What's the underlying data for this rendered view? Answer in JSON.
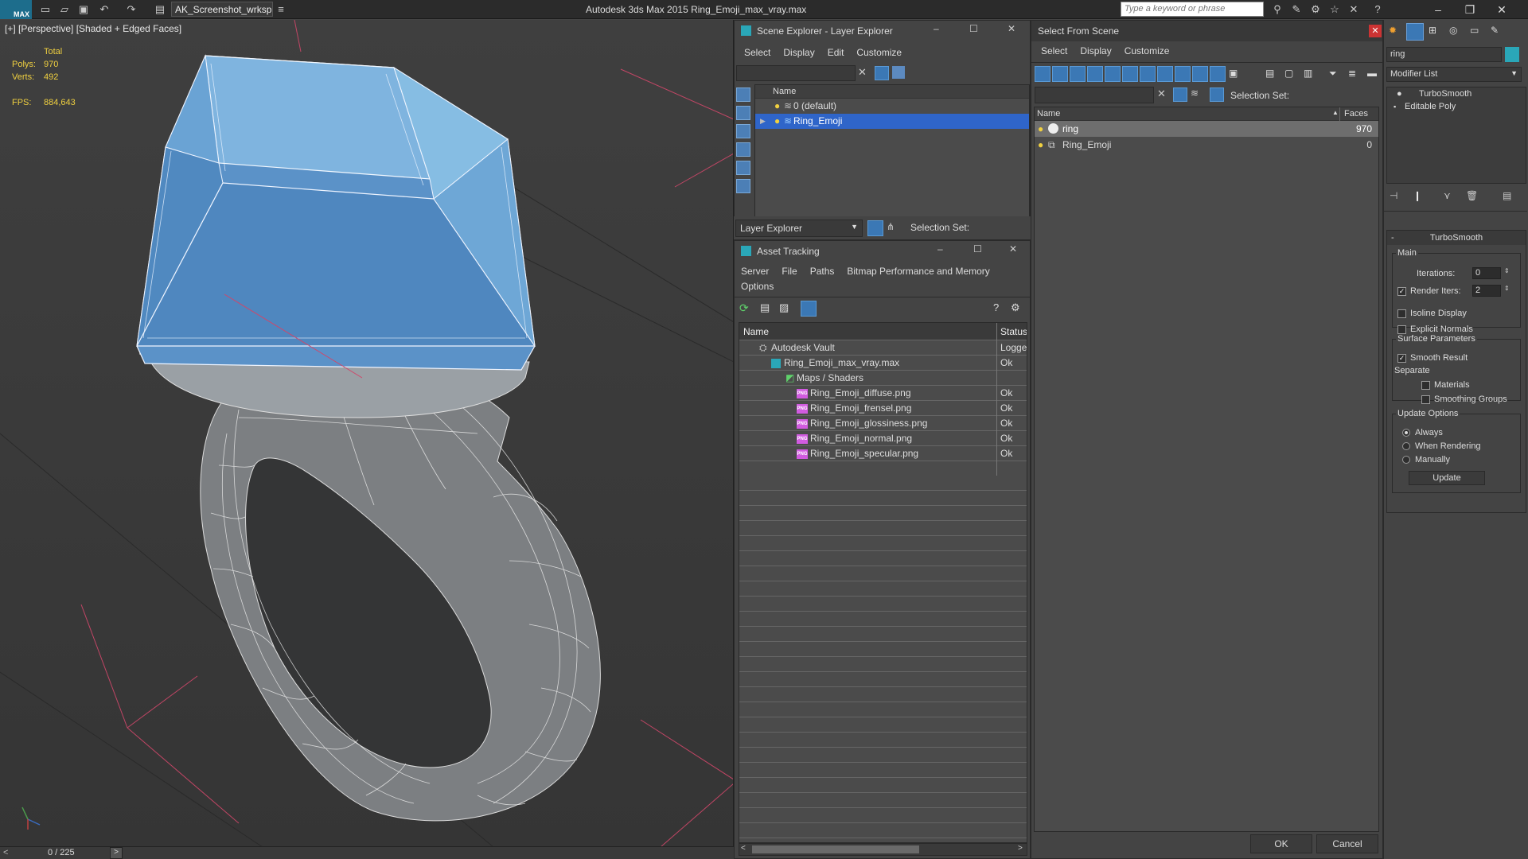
{
  "titlebar": {
    "logo": "MAX",
    "workspace": "AK_Screenshot_wrksp",
    "app_title": "Autodesk 3ds Max  2015     Ring_Emoji_max_vray.max",
    "search_placeholder": "Type a keyword or phrase"
  },
  "viewport": {
    "label": "[+] [Perspective] [Shaded + Edged Faces]",
    "stats": {
      "total_label": "Total",
      "polys_label": "Polys:",
      "polys": "970",
      "verts_label": "Verts:",
      "verts": "492",
      "fps_label": "FPS:",
      "fps": "884,643"
    },
    "frame_counter": "0 / 225"
  },
  "scene_explorer": {
    "title": "Scene Explorer - Layer Explorer",
    "menu": [
      "Select",
      "Display",
      "Edit",
      "Customize"
    ],
    "column_name": "Name",
    "layers": [
      {
        "name": "0 (default)",
        "selected": false
      },
      {
        "name": "Ring_Emoji",
        "selected": true
      }
    ],
    "footer_dropdown": "Layer Explorer",
    "selection_set_label": "Selection Set:"
  },
  "asset_tracking": {
    "title": "Asset Tracking",
    "menu": [
      "Server",
      "File",
      "Paths",
      "Bitmap Performance and Memory",
      "Options"
    ],
    "columns": [
      "Name",
      "Status"
    ],
    "rows": [
      {
        "name": "Autodesk Vault",
        "status": "Logged",
        "indent": 1,
        "icon": "vault-icon"
      },
      {
        "name": "Ring_Emoji_max_vray.max",
        "status": "Ok",
        "indent": 2,
        "icon": "max-file-icon"
      },
      {
        "name": "Maps / Shaders",
        "status": "",
        "indent": 3,
        "icon": "maps-icon"
      },
      {
        "name": "Ring_Emoji_diffuse.png",
        "status": "Ok",
        "indent": 4,
        "icon": "png-icon"
      },
      {
        "name": "Ring_Emoji_frensel.png",
        "status": "Ok",
        "indent": 4,
        "icon": "png-icon"
      },
      {
        "name": "Ring_Emoji_glossiness.png",
        "status": "Ok",
        "indent": 4,
        "icon": "png-icon"
      },
      {
        "name": "Ring_Emoji_normal.png",
        "status": "Ok",
        "indent": 4,
        "icon": "png-icon"
      },
      {
        "name": "Ring_Emoji_specular.png",
        "status": "Ok",
        "indent": 4,
        "icon": "png-icon"
      }
    ]
  },
  "select_from_scene": {
    "title": "Select From Scene",
    "menu": [
      "Select",
      "Display",
      "Customize"
    ],
    "selection_set_label": "Selection Set:",
    "columns": [
      "Name",
      "Faces"
    ],
    "rows": [
      {
        "name": "ring",
        "faces": "970",
        "selected": true
      },
      {
        "name": "Ring_Emoji",
        "faces": "0",
        "selected": false
      }
    ],
    "ok": "OK",
    "cancel": "Cancel"
  },
  "command_panel": {
    "name_field": "ring",
    "modifier_list": "Modifier List",
    "stack": [
      "TurboSmooth",
      "Editable Poly"
    ],
    "rollout_title": "TurboSmooth",
    "main_group": "Main",
    "iterations_label": "Iterations:",
    "iterations": "0",
    "render_iters_label": "Render Iters:",
    "render_iters": "2",
    "isoline_display": "Isoline Display",
    "explicit_normals": "Explicit Normals",
    "surface_group": "Surface Parameters",
    "smooth_result": "Smooth Result",
    "separate_label": "Separate",
    "materials": "Materials",
    "smoothing_groups": "Smoothing Groups",
    "update_group": "Update Options",
    "always": "Always",
    "when_rendering": "When Rendering",
    "manually": "Manually",
    "update_button": "Update"
  },
  "colors": {
    "selection_blue": "#2f65c9",
    "gem_blue": "#6aa6d4",
    "grid_red": "#d0476a",
    "stat_yellow": "#f0d040"
  }
}
